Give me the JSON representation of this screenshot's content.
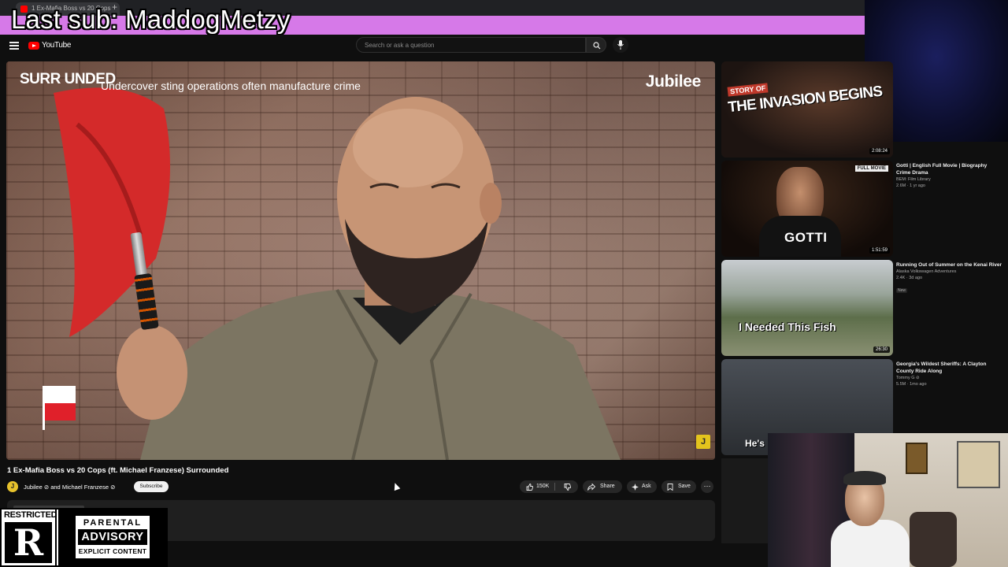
{
  "browser": {
    "tab_title": "1 Ex-Mafia Boss vs 20 Cops",
    "new_tab": "+"
  },
  "overlay": {
    "banner_text": "Last sub: MaddogMetzy",
    "banner_color": "#d679e8"
  },
  "header": {
    "logo_text": "YouTube",
    "search_placeholder": "Search or ask a question",
    "icons": [
      "menu-icon",
      "youtube-logo-icon",
      "search-icon",
      "mic-icon"
    ]
  },
  "player": {
    "series_logo": "SURR UNDED",
    "caption": "Undercover sting operations often manufacture crime",
    "brand": "Jubilee",
    "corner_logo": "J"
  },
  "video": {
    "title": "1 Ex-Mafia Boss vs 20 Cops (ft. Michael Franzese) Surrounded",
    "channel_line": "Jubilee ⊘ and Michael Franzese ⊘",
    "channel_avatar": "J",
    "subscribe_label": "Subscribe",
    "like_count": "150K",
    "share_label": "Share",
    "ask_label": "Ask",
    "save_label": "Save",
    "more_label": "⋯"
  },
  "recommendations": [
    {
      "thumb_tag": "STORY OF",
      "thumb_text": "THE INVASION BEGINS",
      "duration": "2:08:24"
    },
    {
      "title": "Gotti | English Full Movie | Biography Crime Drama",
      "channel": "BEM: Film Library",
      "meta": "2.6M · 1 yr ago",
      "thumb_badge": "FULL MOVIE",
      "thumb_text": "GOTTI",
      "duration": "1:51:59"
    },
    {
      "title": "Running Out of Summer on the Kenai River",
      "channel": "Alaska Volkswagen Adventures",
      "meta": "2.4K · 3d ago",
      "badge": "New",
      "thumb_text": "I Needed This Fish",
      "duration": "26:30"
    },
    {
      "title": "Georgia's Wildest Sheriffs: A Clayton County Ride Along",
      "channel": "Tommy G ⊘",
      "meta": "5.5M · 1mo ago",
      "thumb_text": "He's"
    }
  ],
  "restricted_badge": {
    "title": "RESTRICTED",
    "letter": "R",
    "line1": "PARENTAL",
    "line2": "ADVISORY",
    "line3": "EXPLICIT CONTENT"
  }
}
